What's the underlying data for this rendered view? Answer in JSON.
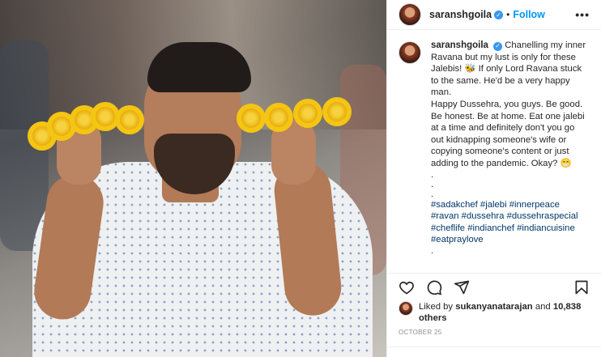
{
  "post": {
    "username": "saranshgoila",
    "follow_label": "Follow",
    "more_icon": "more-options-icon",
    "caption": {
      "line1": "Chanelling my inner Ravana but my lust is only for these Jalebis! 🐝 If only Lord Ravana stuck to the same. He'd be a very happy man.",
      "line2": "Happy Dussehra, you guys. Be good. Be honest. Be at home. Eat one jalebi at a time and definitely don't you go out kidnapping someone's wife or copying someone's content or just adding to the pandemic. Okay? 😁",
      "dots": ".\n.\n.",
      "hashtags": "#sadakchef #jalebi #innerpeace #ravan #dussehra #dussehraspecial #cheflife #indianchef #indiancuisine #eatpraylove",
      "trail": "."
    },
    "likes": {
      "prefix": "Liked by",
      "user": "sukanyanatarajan",
      "and": "and",
      "others": "10,838 others"
    },
    "date": "OCTOBER 25"
  }
}
